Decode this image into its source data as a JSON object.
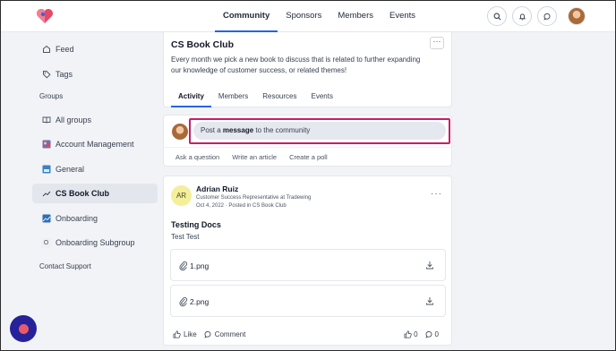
{
  "header": {
    "nav": [
      {
        "label": "Community",
        "active": true
      },
      {
        "label": "Sponsors",
        "active": false
      },
      {
        "label": "Members",
        "active": false
      },
      {
        "label": "Events",
        "active": false
      }
    ],
    "icons": [
      "search-icon",
      "bell-icon",
      "chat-icon"
    ]
  },
  "sidebar": {
    "feed": "Feed",
    "tags": "Tags",
    "groups_heading": "Groups",
    "items": [
      {
        "label": "All groups",
        "icon": "book-icon"
      },
      {
        "label": "Account Management",
        "icon": "group-image-icon"
      },
      {
        "label": "General",
        "icon": "group-image-icon"
      },
      {
        "label": "CS Book Club",
        "icon": "group-image-icon",
        "active": true
      },
      {
        "label": "Onboarding",
        "icon": "group-image-icon"
      },
      {
        "label": "Onboarding Subgroup",
        "icon": "letter-o-icon",
        "badge": "O"
      }
    ],
    "support": "Contact Support"
  },
  "group": {
    "title": "CS Book Club",
    "description": "Every month we pick a new book to discuss that is related to further expanding our knowledge of customer success, or related themes!",
    "tabs": [
      {
        "label": "Activity",
        "active": true
      },
      {
        "label": "Members",
        "active": false
      },
      {
        "label": "Resources",
        "active": false
      },
      {
        "label": "Events",
        "active": false
      }
    ]
  },
  "composer": {
    "prefix": "Post a ",
    "bold": "message",
    "suffix": " to the community",
    "actions": [
      "Ask a question",
      "Write an article",
      "Create a poll"
    ]
  },
  "post": {
    "initials": "AR",
    "author": "Adrian Ruiz",
    "role": "Customer Success Representative at Tradewing",
    "meta": "Oct 4, 2022 · Posted in CS Book Club",
    "title": "Testing Docs",
    "body": "Test Test",
    "attachments": [
      "1.png",
      "2.png"
    ],
    "like_label": "Like",
    "comment_label": "Comment",
    "like_count": "0",
    "comment_count": "0"
  },
  "colors": {
    "accent": "#2563eb",
    "highlight": "#c81e6a",
    "fab": "#26229a"
  }
}
